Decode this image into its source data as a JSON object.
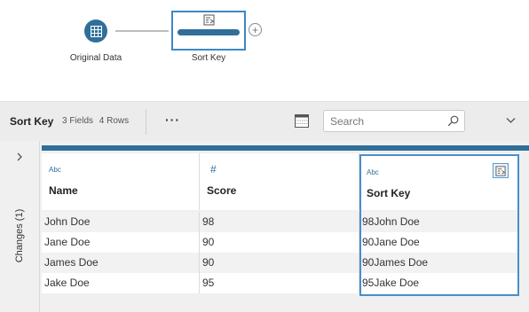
{
  "flow": {
    "input_node_label": "Original Data",
    "step_node_label": "Sort Key",
    "add_symbol": "+"
  },
  "toolbar": {
    "title": "Sort Key",
    "fields": "3 Fields",
    "rows": "4 Rows",
    "more_label": "···",
    "search_placeholder": "Search"
  },
  "side_panel": {
    "label": "Changes (1)"
  },
  "grid": {
    "columns": [
      {
        "name": "Name",
        "type_label": "Abc"
      },
      {
        "name": "Score",
        "type_label": "#"
      },
      {
        "name": "Sort Key",
        "type_label": "Abc"
      }
    ],
    "rows": [
      [
        "John Doe",
        "98",
        "98John Doe"
      ],
      [
        "Jane Doe",
        "90",
        "90Jane Doe"
      ],
      [
        "James Doe",
        "90",
        "90James Doe"
      ],
      [
        "Jake Doe",
        "95",
        "95Jake Doe"
      ]
    ]
  },
  "colors": {
    "accent": "#2f6f9a",
    "selection": "#4a8fc8"
  }
}
